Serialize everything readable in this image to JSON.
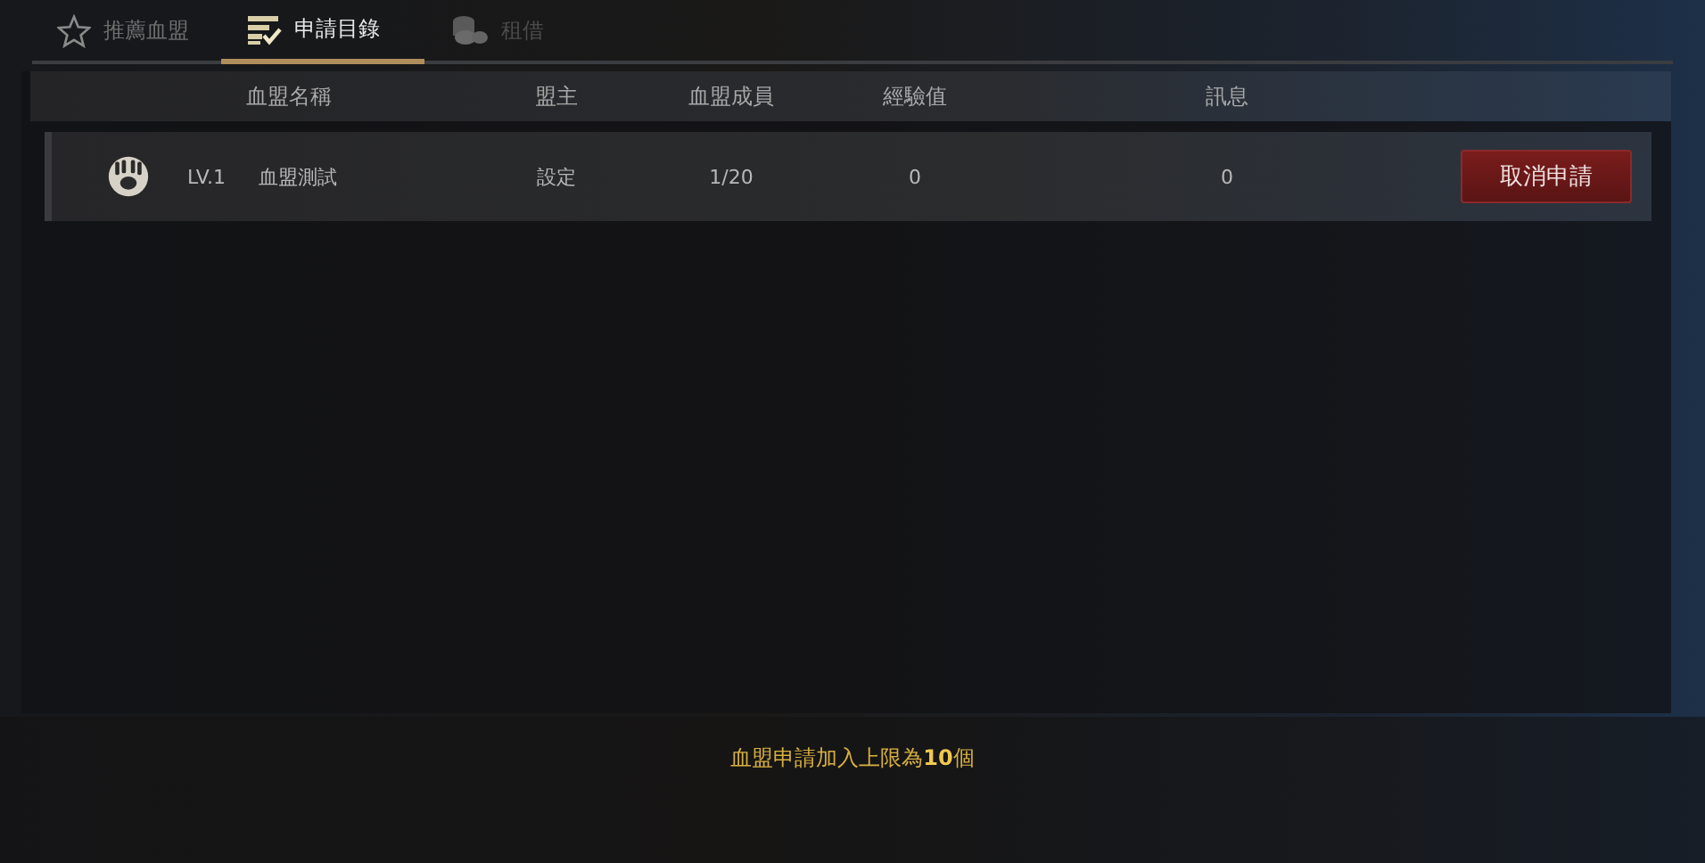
{
  "tabs": [
    {
      "label": "推薦血盟",
      "selected": false,
      "disabled": false
    },
    {
      "label": "申請目錄",
      "selected": true,
      "disabled": false
    },
    {
      "label": "租借",
      "selected": false,
      "disabled": true
    }
  ],
  "table": {
    "columns": [
      "血盟名稱",
      "盟主",
      "血盟成員",
      "經驗值",
      "訊息"
    ],
    "rows": [
      {
        "level": "LV.1",
        "name": "血盟測試",
        "leader": "設定",
        "members": "1/20",
        "experience": "0",
        "messages": "0",
        "action": "取消申請"
      }
    ]
  },
  "footer_note": "血盟申請加入上限為**10**個"
}
